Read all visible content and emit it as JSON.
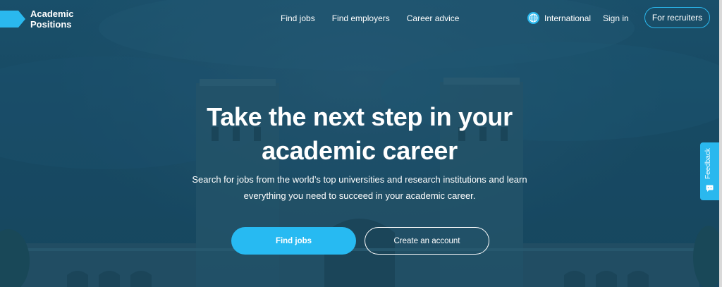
{
  "brand": {
    "name_line1": "Academic",
    "name_line2": "Positions",
    "accent_color": "#2ab8ee"
  },
  "nav": {
    "links": [
      {
        "label": "Find jobs"
      },
      {
        "label": "Find employers"
      },
      {
        "label": "Career advice"
      }
    ],
    "region": {
      "label": "International",
      "icon": "globe-icon"
    },
    "signin_label": "Sign in",
    "recruiters_label": "For recruiters"
  },
  "hero": {
    "title_line1": "Take the next step in your",
    "title_line2": "academic career",
    "subtitle_line1": "Search for jobs from the world’s top universities and research institutions and learn",
    "subtitle_line2": "everything you need to succeed in your academic career.",
    "primary_cta": "Find jobs",
    "secondary_cta": "Create an account"
  },
  "feedback": {
    "label": "Feedback",
    "icon": "feedback-icon"
  }
}
